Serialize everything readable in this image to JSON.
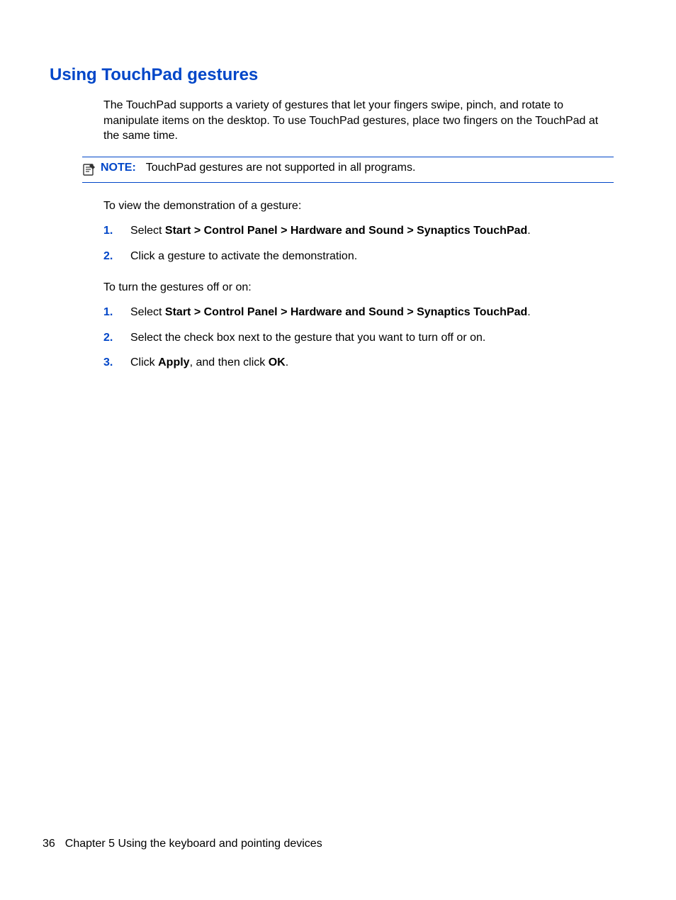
{
  "heading": "Using TouchPad gestures",
  "intro": "The TouchPad supports a variety of gestures that let your fingers swipe, pinch, and rotate to manipulate items on the desktop. To use TouchPad gestures, place two fingers on the TouchPad at the same time.",
  "note": {
    "label": "NOTE:",
    "text": "TouchPad gestures are not supported in all programs."
  },
  "para1": "To view the demonstration of a gesture:",
  "list1": {
    "step1": {
      "num": "1.",
      "pre": "Select ",
      "bold": "Start > Control Panel > Hardware and Sound > Synaptics TouchPad",
      "post": "."
    },
    "step2": {
      "num": "2.",
      "text": "Click a gesture to activate the demonstration."
    }
  },
  "para2": "To turn the gestures off or on:",
  "list2": {
    "step1": {
      "num": "1.",
      "pre": "Select ",
      "bold": "Start > Control Panel > Hardware and Sound > Synaptics TouchPad",
      "post": "."
    },
    "step2": {
      "num": "2.",
      "text": "Select the check box next to the gesture that you want to turn off or on."
    },
    "step3": {
      "num": "3.",
      "pre": "Click ",
      "bold1": "Apply",
      "mid": ", and then click ",
      "bold2": "OK",
      "post": "."
    }
  },
  "footer": {
    "pageNum": "36",
    "chapter": "Chapter 5   Using the keyboard and pointing devices"
  }
}
